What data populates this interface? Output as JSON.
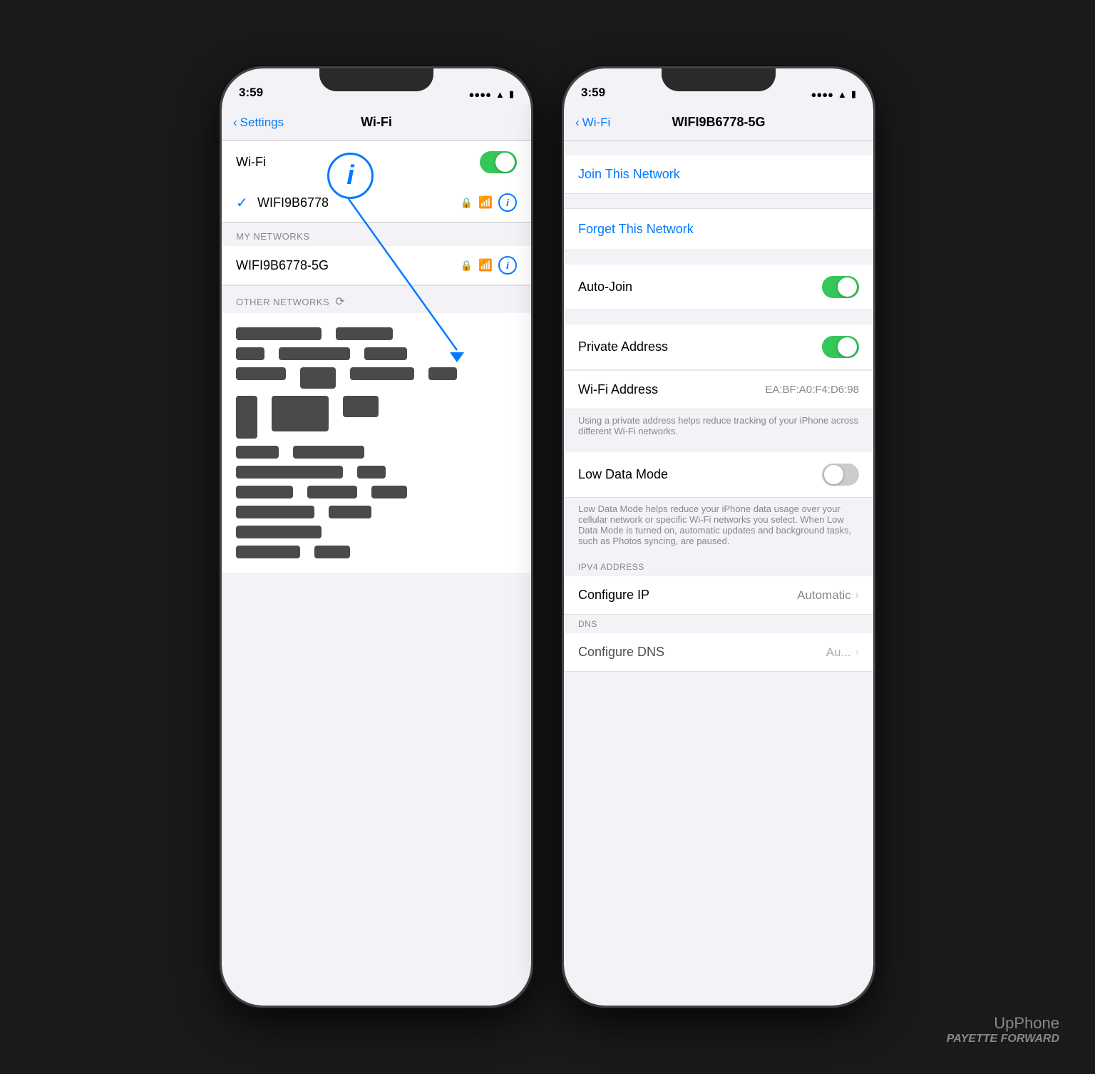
{
  "phone1": {
    "status_bar": {
      "time": "3:59",
      "signal_bars": "▪▪▪▪",
      "wifi": "WiFi",
      "battery": "🔋"
    },
    "nav": {
      "back_label": "Settings",
      "title": "Wi-Fi"
    },
    "wifi_toggle": {
      "label": "Wi-Fi",
      "state": "on"
    },
    "connected_network": {
      "name": "WIFI9B6778",
      "checkmark": "✓"
    },
    "my_networks_header": "MY NETWORKS",
    "my_networks": [
      {
        "name": "WIFI9B6778-5G"
      }
    ],
    "other_networks_header": "OTHER NETWORKS",
    "info_button_label": "i"
  },
  "phone2": {
    "status_bar": {
      "time": "3:59"
    },
    "nav": {
      "back_label": "Wi-Fi",
      "title": "WIFI9B6778-5G"
    },
    "join_network": "Join This Network",
    "forget_network": "Forget This Network",
    "settings": [
      {
        "label": "Auto-Join",
        "type": "toggle",
        "value": "on"
      },
      {
        "label": "Private Address",
        "type": "toggle",
        "value": "on"
      },
      {
        "label": "Wi-Fi Address",
        "type": "value",
        "value": "EA:BF:A0:F4:D6:98"
      }
    ],
    "private_address_note": "Using a private address helps reduce tracking of your iPhone across different Wi-Fi networks.",
    "low_data_mode": {
      "label": "Low Data Mode",
      "value": "off"
    },
    "low_data_note": "Low Data Mode helps reduce your iPhone data usage over your cellular network or specific Wi-Fi networks you select. When Low Data Mode is turned on, automatic updates and background tasks, such as Photos syncing, are paused.",
    "ipv4_header": "IPV4 ADDRESS",
    "configure_ip": {
      "label": "Configure IP",
      "value": "Automatic"
    },
    "dns_header": "DNS",
    "configure_dns_label": "Configure DNS",
    "configure_dns_value": "Au..."
  },
  "watermark": {
    "top": "UpPhone",
    "bottom": "PAYETTE FORWARD"
  }
}
